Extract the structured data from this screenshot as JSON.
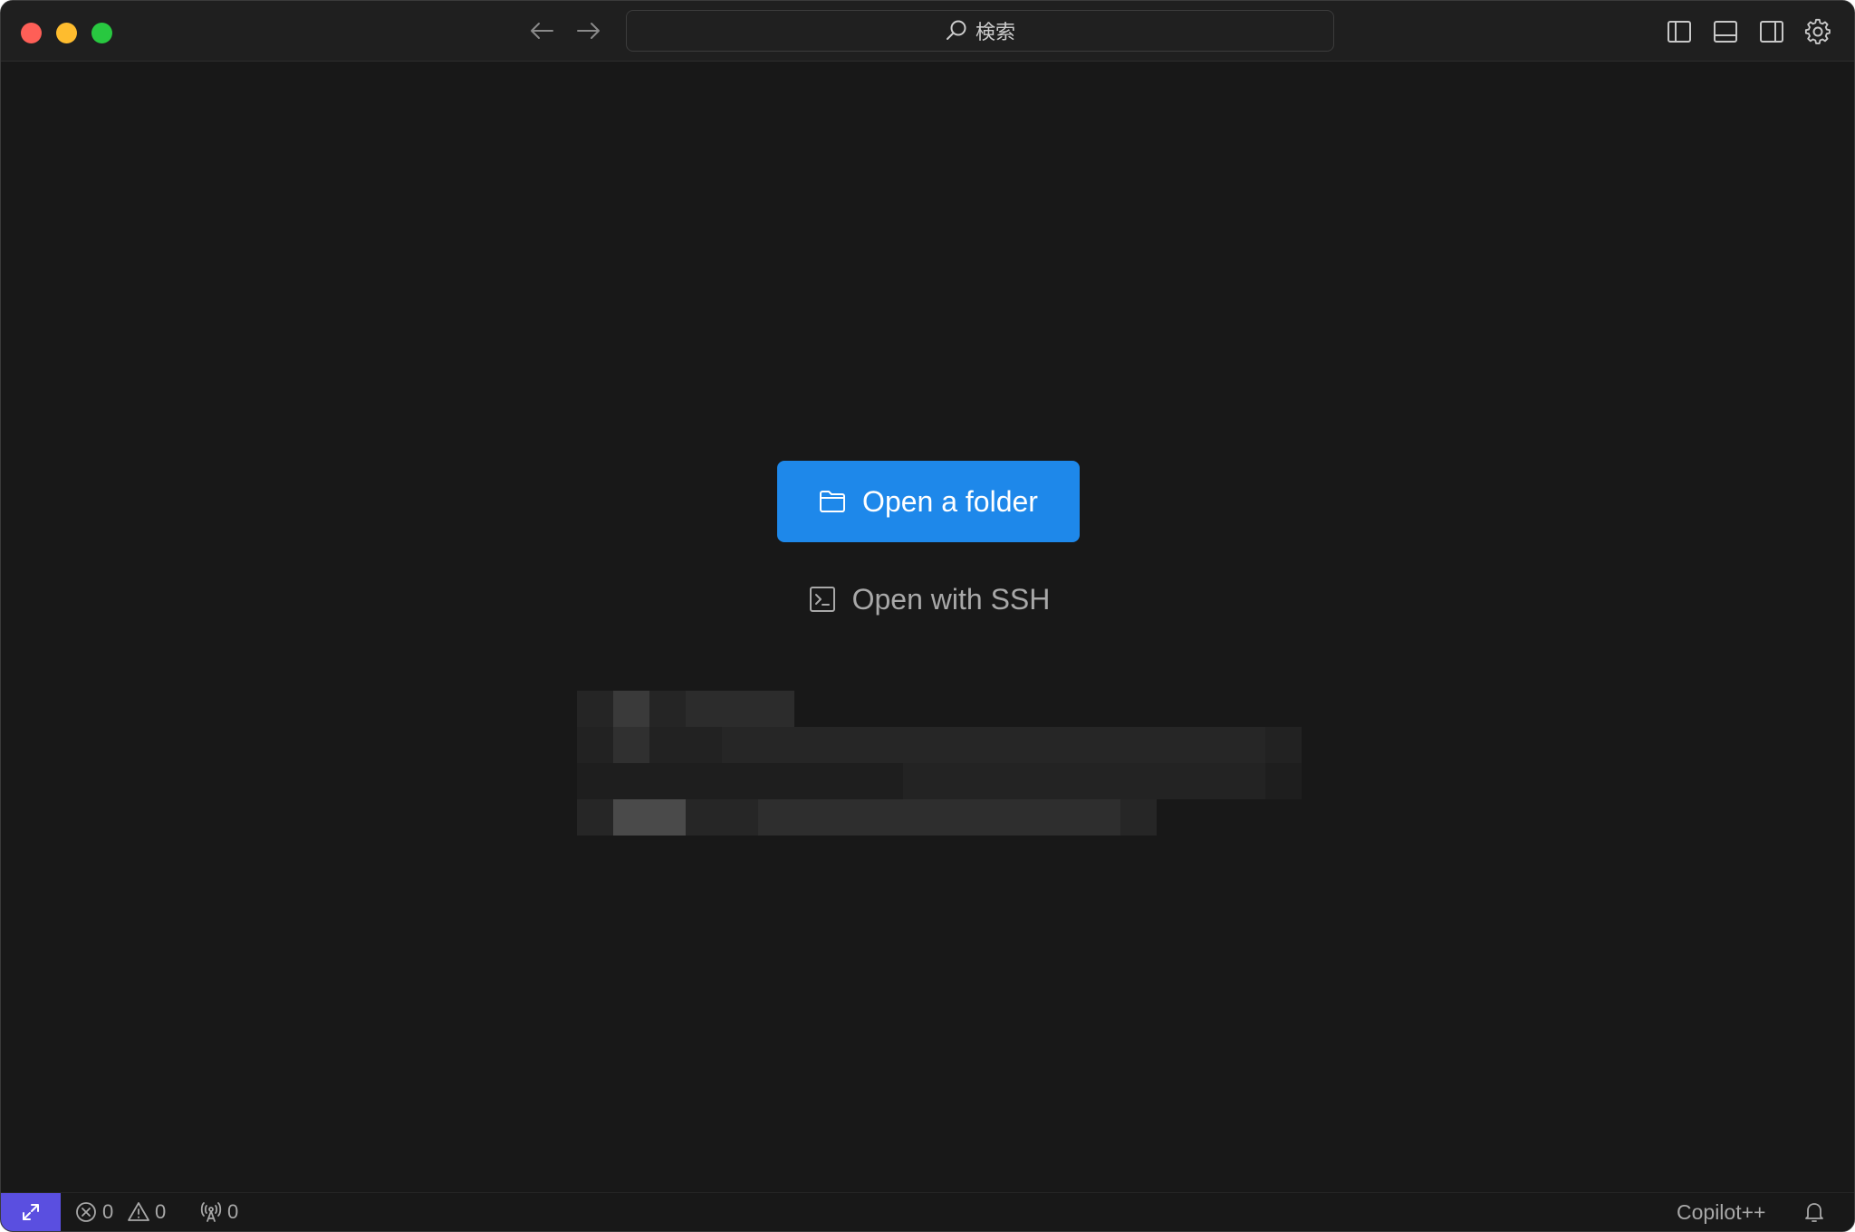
{
  "titlebar": {
    "search": {
      "label": "検索"
    },
    "icons": [
      "arrow-left-icon",
      "arrow-right-icon",
      "search-icon",
      "toggle-primary-sidebar-icon",
      "toggle-panel-icon",
      "toggle-secondary-sidebar-icon",
      "gear-icon"
    ]
  },
  "main": {
    "open_folder_label": "Open a folder",
    "open_ssh_label": "Open with SSH"
  },
  "statusbar": {
    "errors": "0",
    "warnings": "0",
    "ports": "0",
    "copilot_label": "Copilot++"
  },
  "colors": {
    "window_bg": "#181818",
    "titlebar_bg": "#1f1f1f",
    "accent_button": "#1e88ea",
    "remote_button": "#5a4fe0",
    "traffic_red": "#fe5f57",
    "traffic_yellow": "#febc2e",
    "traffic_green": "#28c840"
  }
}
